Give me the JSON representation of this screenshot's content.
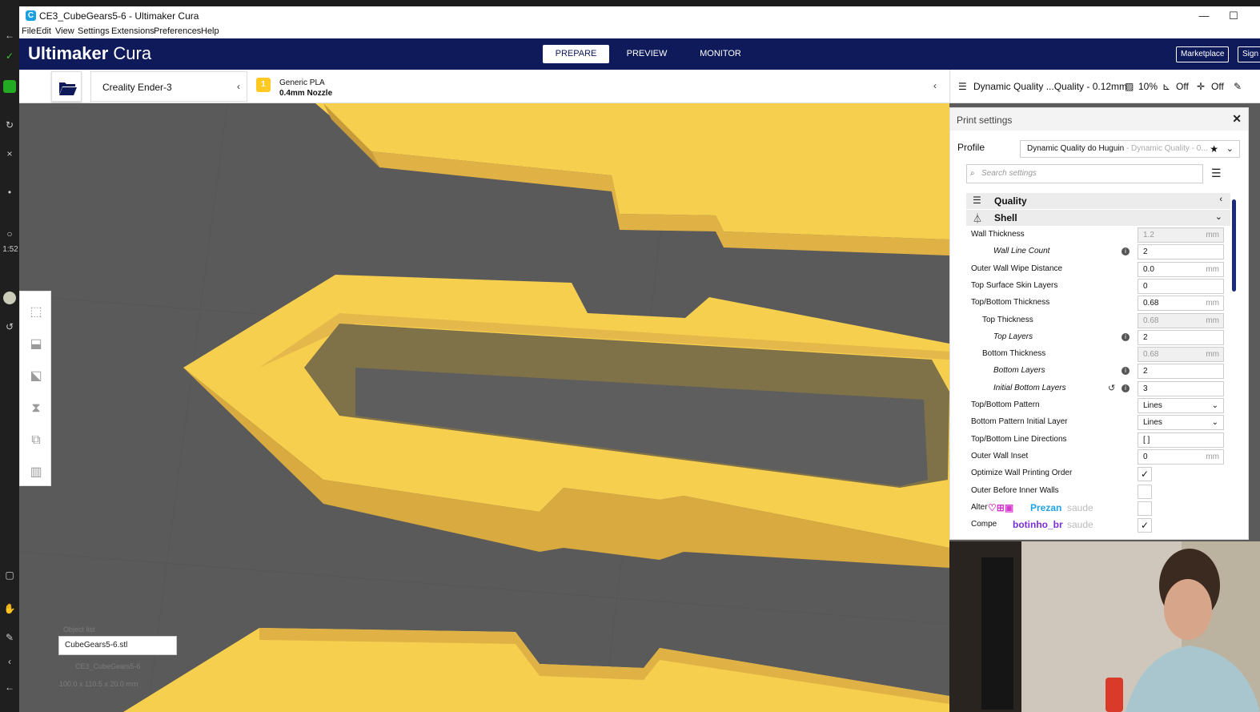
{
  "window": {
    "title": "CE3_CubeGears5-6 - Ultimaker Cura",
    "minimize": "—",
    "maximize": "☐"
  },
  "menu": [
    "File",
    "Edit",
    "View",
    "Settings",
    "Extensions",
    "Preferences",
    "Help"
  ],
  "header": {
    "brand_bold": "Ultimaker",
    "brand_light": " Cura",
    "tabs": [
      "PREPARE",
      "PREVIEW",
      "MONITOR"
    ],
    "active_tab": "PREPARE",
    "marketplace": "Marketplace",
    "signin": "Sign"
  },
  "toolbar": {
    "printer": "Creality Ender-3",
    "extruder_number": "1",
    "material": "Generic PLA",
    "nozzle": "0.4mm Nozzle",
    "profile_summary": "Dynamic Quality ...Quality - 0.12mm",
    "infill": "10%",
    "support": "Off",
    "adhesion": "Off"
  },
  "panel": {
    "title": "Print settings",
    "profile_label": "Profile",
    "profile_value": "Dynamic Quality do Huguin",
    "profile_sub": " - Dynamic Quality - 0...",
    "search_placeholder": "Search settings",
    "categories": [
      {
        "label": "Quality",
        "state": "‹"
      },
      {
        "label": "Shell",
        "state": "⌄"
      }
    ],
    "settings": [
      {
        "label": "Wall Thickness",
        "indent": 0,
        "value": "1.2",
        "unit": "mm",
        "disabled": true
      },
      {
        "label": "Wall Line Count",
        "indent": 2,
        "value": "2",
        "unit": "",
        "info": true
      },
      {
        "label": "Outer Wall Wipe Distance",
        "indent": 0,
        "value": "0.0",
        "unit": "mm"
      },
      {
        "label": "Top Surface Skin Layers",
        "indent": 0,
        "value": "0",
        "unit": ""
      },
      {
        "label": "Top/Bottom Thickness",
        "indent": 0,
        "value": "0.68",
        "unit": "mm"
      },
      {
        "label": "Top Thickness",
        "indent": 1,
        "value": "0.68",
        "unit": "mm",
        "disabled": true
      },
      {
        "label": "Top Layers",
        "indent": 2,
        "value": "2",
        "unit": "",
        "info": true
      },
      {
        "label": "Bottom Thickness",
        "indent": 1,
        "value": "0.68",
        "unit": "mm",
        "disabled": true
      },
      {
        "label": "Bottom Layers",
        "indent": 2,
        "value": "2",
        "unit": "",
        "info": true
      },
      {
        "label": "Initial Bottom Layers",
        "indent": 2,
        "value": "3",
        "unit": "",
        "info": true,
        "reset": true
      },
      {
        "label": "Top/Bottom Pattern",
        "indent": 0,
        "value": "Lines",
        "dropdown": true
      },
      {
        "label": "Bottom Pattern Initial Layer",
        "indent": 0,
        "value": "Lines",
        "dropdown": true
      },
      {
        "label": "Top/Bottom Line Directions",
        "indent": 0,
        "value": "[ ]",
        "unit": ""
      },
      {
        "label": "Outer Wall Inset",
        "indent": 0,
        "value": "0",
        "unit": "mm"
      },
      {
        "label": "Optimize Wall Printing Order",
        "indent": 0,
        "checkbox": true,
        "checked": true
      },
      {
        "label": "Outer Before Inner Walls",
        "indent": 0,
        "checkbox": true,
        "checked": false
      },
      {
        "label": "Alter",
        "indent": 0,
        "checkbox": true,
        "checked": false
      },
      {
        "label": "Compe",
        "indent": 0,
        "checkbox": true,
        "checked": true
      }
    ]
  },
  "viewport": {
    "object_name": "CubeGears5-6.stl",
    "ghost_1": "Object list",
    "ghost_2": "CE3_CubeGears5-6",
    "ghost_3": "100.0 x 110.5 x 20.0 mm"
  },
  "overlay": {
    "viewer_1": "Prezan",
    "viewer_1_msg": "saude",
    "viewer_2": "botinho_br",
    "viewer_2_msg": "saude"
  },
  "obs": {
    "time": "1:52"
  },
  "colors": {
    "header_bg": "#0e1a5a",
    "model_yellow": "#f7cf4e",
    "model_shadow": "#8c8155",
    "accent_blue": "#1a2a7c"
  }
}
